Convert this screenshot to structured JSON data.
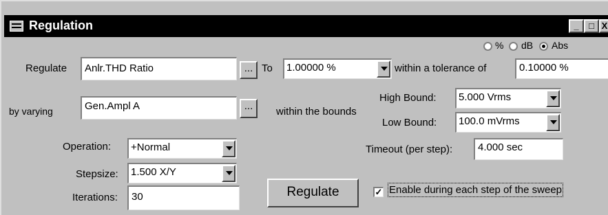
{
  "window": {
    "title": "Regulation",
    "buttons": {
      "minimize": "_",
      "maximize": "□",
      "close": "X"
    }
  },
  "units": {
    "percent": "%",
    "db": "dB",
    "abs": "Abs",
    "selected": "Abs"
  },
  "regulate": {
    "label": "Regulate",
    "value": "Anlr.THD Ratio",
    "browse": "...",
    "to_label": "To",
    "target_value": "1.00000  %",
    "tolerance_label": "within a tolerance of",
    "tolerance_value": "0.10000  %"
  },
  "varying": {
    "label": "by varying",
    "value": "Gen.Ampl A",
    "browse": "...",
    "bounds_label": "within the bounds",
    "high_label": "High Bound:",
    "high_value": "5.000    Vrms",
    "low_label": "Low Bound:",
    "low_value": "100.0   mVrms"
  },
  "operation": {
    "label": "Operation:",
    "value": "+Normal"
  },
  "timeout": {
    "label": "Timeout (per step):",
    "value": "4.000    sec"
  },
  "stepsize": {
    "label": "Stepsize:",
    "value": "1.500   X/Y"
  },
  "iterations": {
    "label": "Iterations:",
    "value": "30"
  },
  "regulate_button": "Regulate",
  "sweep": {
    "label": "Enable during each step of the sweep",
    "checked": true
  }
}
